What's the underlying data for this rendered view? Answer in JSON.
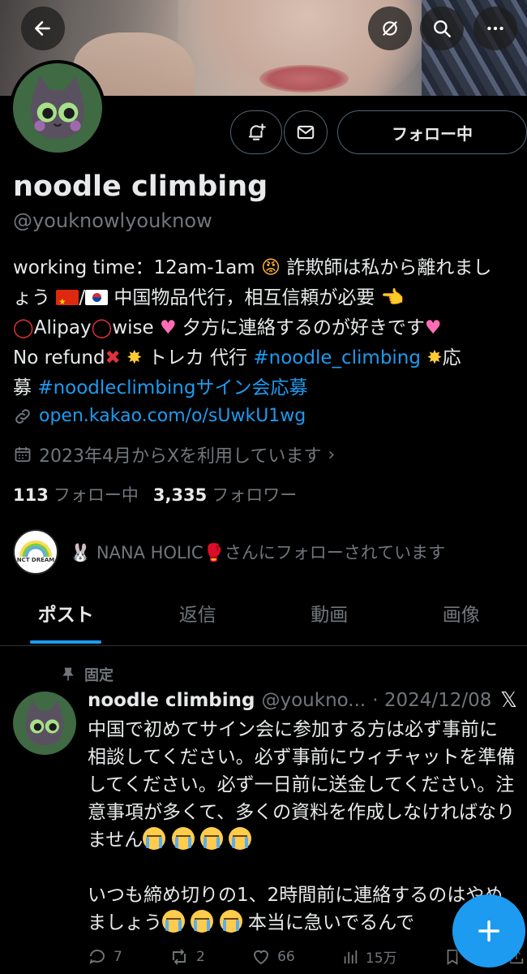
{
  "profile": {
    "name": "noodle climbing",
    "handle": "@youknowlyouknow",
    "follow_button": "フォロー中",
    "bio": {
      "l1a": "working time：12am-1am ",
      "l1b": "詐欺師は私から離れまし",
      "l2a": "ょう",
      "l2b": "/",
      "l2c": "中国物品代行，相互信頼が必要 ",
      "l3a": "Alipay",
      "l3b": "wise ",
      "l3c": " 夕方に連絡するのが好きです",
      "l4a": "No refund",
      "l4b": " トレカ 代行 ",
      "l4c": "#noodle_climbing",
      "l4d": "応",
      "l5a": "募 ",
      "l5b": "#noodleclimbingサイン会応募"
    },
    "link": "open.kakao.com/o/sUwkU1wg",
    "joined": "2023年4月からXを利用しています",
    "following_count": "113",
    "following_label": "フォロー中",
    "followers_count": "3,335",
    "followers_label": "フォロワー",
    "followed_by_avatar_text": "NCT DREAM",
    "followed_by_text": "NANA HOLIC",
    "followed_by_suffix": "さんにフォローされています"
  },
  "tabs": [
    "ポスト",
    "返信",
    "動画",
    "画像"
  ],
  "post": {
    "pinned_label": "固定",
    "name": "noodle climbing",
    "handle": "@youkno...",
    "date": "· 2024/12/08",
    "p1": "中国で初めてサイン会に参加する方は必ず事前に相談してください。必ず事前にウィチャットを準備してください。必ず一日前に送金してください。注意事項が多くて、多くの資料を作成しなければなりません",
    "p2": "いつも締め切りの1、2時間前に連絡するのはやめましょう",
    "p2b": " 本当に急いでるんで",
    "replies": "7",
    "reposts": "2",
    "likes": "66",
    "views": "15万"
  },
  "colors": {
    "accent": "#1d9bf0",
    "muted": "#71767b",
    "bg": "#000000"
  }
}
